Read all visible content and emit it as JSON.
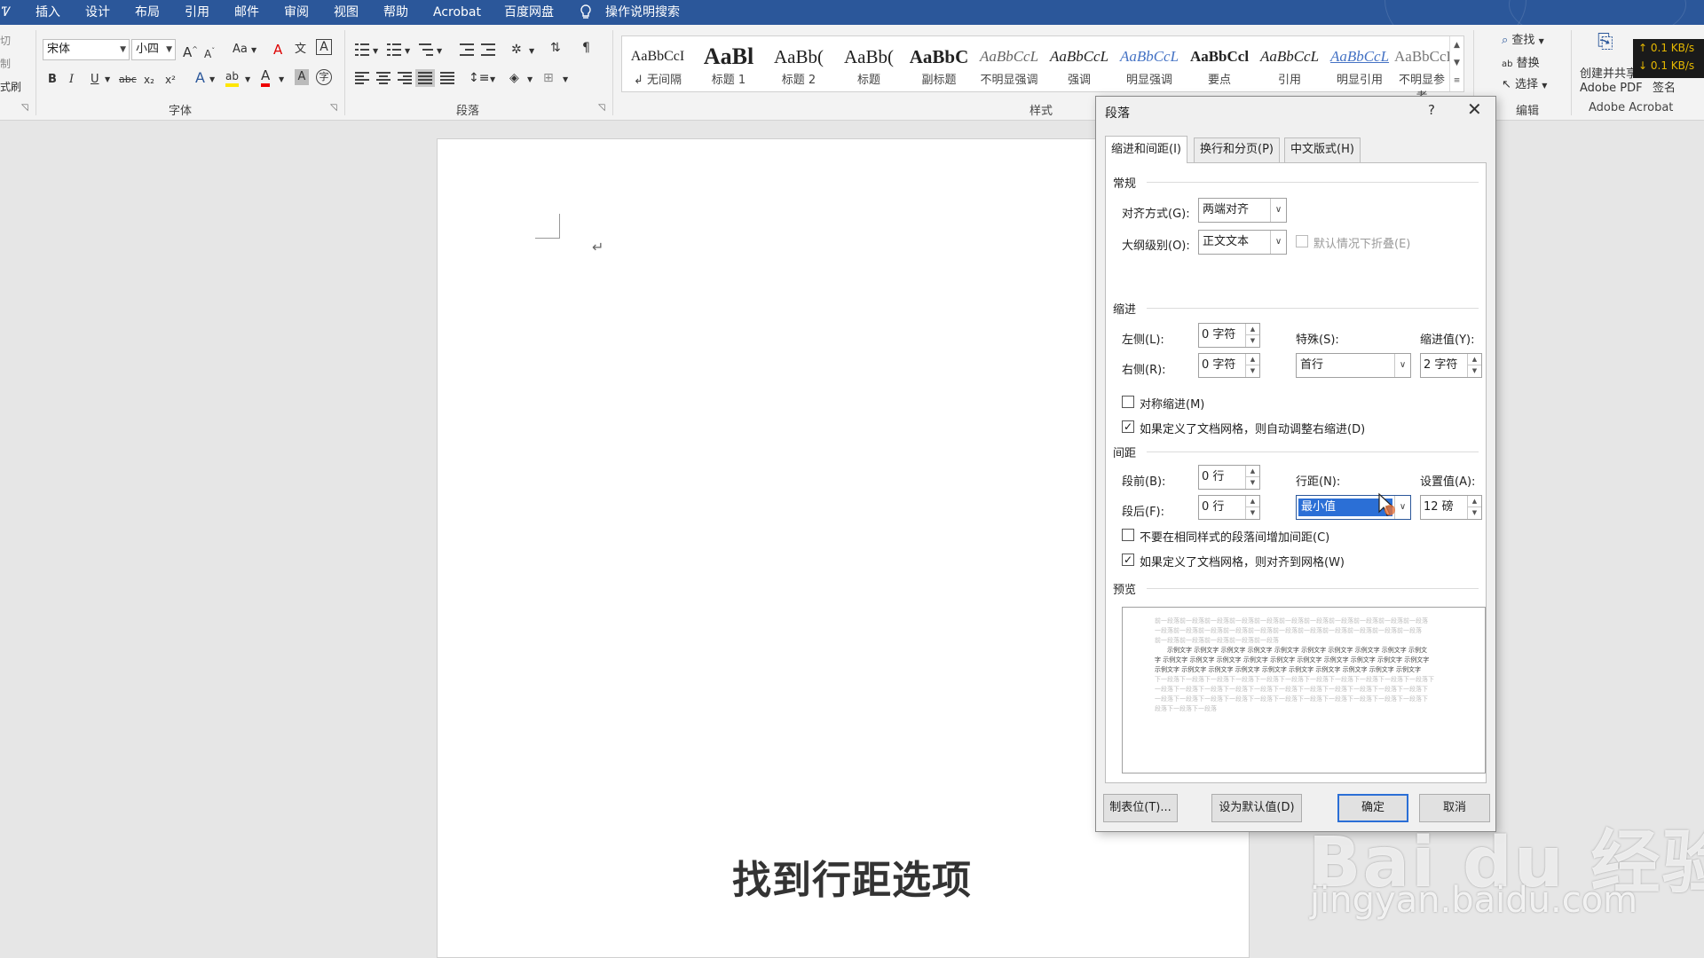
{
  "menu_tabs": [
    "Ꮴ",
    "插入",
    "设计",
    "布局",
    "引用",
    "邮件",
    "审阅",
    "视图",
    "帮助",
    "Acrobat",
    "百度网盘",
    "操作说明搜索"
  ],
  "clipboard": {
    "cut_partial": "切",
    "copy_partial": "制",
    "format_painter_partial": "式刷"
  },
  "font": {
    "name": "宋体",
    "size": "小四",
    "grow": "A",
    "shrink": "A",
    "case": "Aa",
    "clear": "A",
    "phonetic": "文",
    "border_char": "A",
    "bold": "B",
    "italic": "I",
    "underline": "U",
    "strike": "abc",
    "subscript": "x₂",
    "superscript": "x²",
    "effects": "A",
    "highlight": "ab",
    "color": "A",
    "shading": "A",
    "enclose": "字",
    "group_label": "字体"
  },
  "paragraph": {
    "group_label": "段落"
  },
  "styles": {
    "group_label": "样式",
    "items": [
      {
        "sample": "AaBbCcI",
        "name": "↲ 无间隔"
      },
      {
        "sample": "AaBl",
        "name": "标题 1"
      },
      {
        "sample": "AaBb(",
        "name": "标题 2"
      },
      {
        "sample": "AaBb(",
        "name": "标题"
      },
      {
        "sample": "AaBbC",
        "name": "副标题"
      },
      {
        "sample": "AaBbCcL",
        "name": "不明显强调"
      },
      {
        "sample": "AaBbCcL",
        "name": "强调"
      },
      {
        "sample": "AaBbCcL",
        "name": "明显强调"
      },
      {
        "sample": "AaBbCcl",
        "name": "要点"
      },
      {
        "sample": "AaBbCcL",
        "name": "引用"
      },
      {
        "sample": "AaBbCcL",
        "name": "明显引用"
      },
      {
        "sample": "AaBbCcD",
        "name": "不明显参考"
      }
    ]
  },
  "editing": {
    "find": "查找",
    "replace": "替换",
    "select": "选择",
    "group_label": "编辑"
  },
  "acrobat": {
    "create_share": "创建并共享",
    "pdf": "Adobe PDF",
    "sign": "签名",
    "group_label": "Adobe Acrobat"
  },
  "netspeed": {
    "up": "↑ 0.1 KB/s",
    "down": "↓ 0.1 KB/s"
  },
  "document": {
    "paragraph_mark": "↵"
  },
  "dialog": {
    "title": "段落",
    "help": "?",
    "close": "✕",
    "tabs": [
      "缩进和间距(I)",
      "换行和分页(P)",
      "中文版式(H)"
    ],
    "general": {
      "section": "常规",
      "alignment_label": "对齐方式(G):",
      "alignment_value": "两端对齐",
      "outline_label": "大纲级别(O):",
      "outline_value": "正文文本",
      "collapse_label": "默认情况下折叠(E)"
    },
    "indent": {
      "section": "缩进",
      "left_label": "左侧(L):",
      "left_value": "0 字符",
      "right_label": "右侧(R):",
      "right_value": "0 字符",
      "special_label": "特殊(S):",
      "special_value": "首行",
      "by_label": "缩进值(Y):",
      "by_value": "2 字符",
      "mirror_label": "对称缩进(M)",
      "mirror_checked": false,
      "auto_right_label": "如果定义了文档网格，则自动调整右缩进(D)",
      "auto_right_checked": true
    },
    "spacing": {
      "section": "间距",
      "before_label": "段前(B):",
      "before_value": "0 行",
      "after_label": "段后(F):",
      "after_value": "0 行",
      "line_label": "行距(N):",
      "line_value": "最小值",
      "at_label": "设置值(A):",
      "at_value": "12 磅",
      "no_space_label": "不要在相同样式的段落间增加间距(C)",
      "no_space_checked": false,
      "snap_grid_label": "如果定义了文档网格，则对齐到网格(W)",
      "snap_grid_checked": true
    },
    "preview": {
      "section": "预览",
      "prev_lines": [
        "前一段落前一段落前一段落前一段落前一段落前一段落前一段落前一段落前一段落前一段落前一段落",
        "一段落前一段落前一段落前一段落前一段落前一段落前一段落前一段落前一段落前一段落前一段落",
        "前一段落前一段落前一段落前一段落前一段落"
      ],
      "sample_lines": [
        "示例文字 示例文字 示例文字 示例文字 示例文字 示例文字 示例文字 示例文字 示例文字 示例文",
        "字 示例文字 示例文字 示例文字 示例文字 示例文字 示例文字 示例文字 示例文字 示例文字 示例文字",
        "示例文字 示例文字 示例文字 示例文字 示例文字 示例文字 示例文字 示例文字 示例文字 示例文字"
      ],
      "next_lines": [
        "下一段落下一段落下一段落下一段落下一段落下一段落下一段落下一段落下一段落下一段落下一段落下",
        "一段落下一段落下一段落下一段落下一段落下一段落下一段落下一段落下一段落下一段落下一段落下",
        "一段落下一段落下一段落下一段落下一段落下一段落下一段落下一段落下一段落下一段落下一段落下",
        "段落下一段落下一段落"
      ]
    },
    "buttons": {
      "tabs": "制表位(T)...",
      "default": "设为默认值(D)",
      "ok": "确定",
      "cancel": "取消"
    }
  },
  "overlay": {
    "subtitle": "找到行距选项",
    "watermark_main": "Bai du 经验",
    "watermark_url": "jingyan.baidu.com"
  },
  "colors": {
    "ribbon_blue": "#2b579a",
    "selection": "#2b6fd6",
    "netspeed_text": "#e6b800"
  }
}
